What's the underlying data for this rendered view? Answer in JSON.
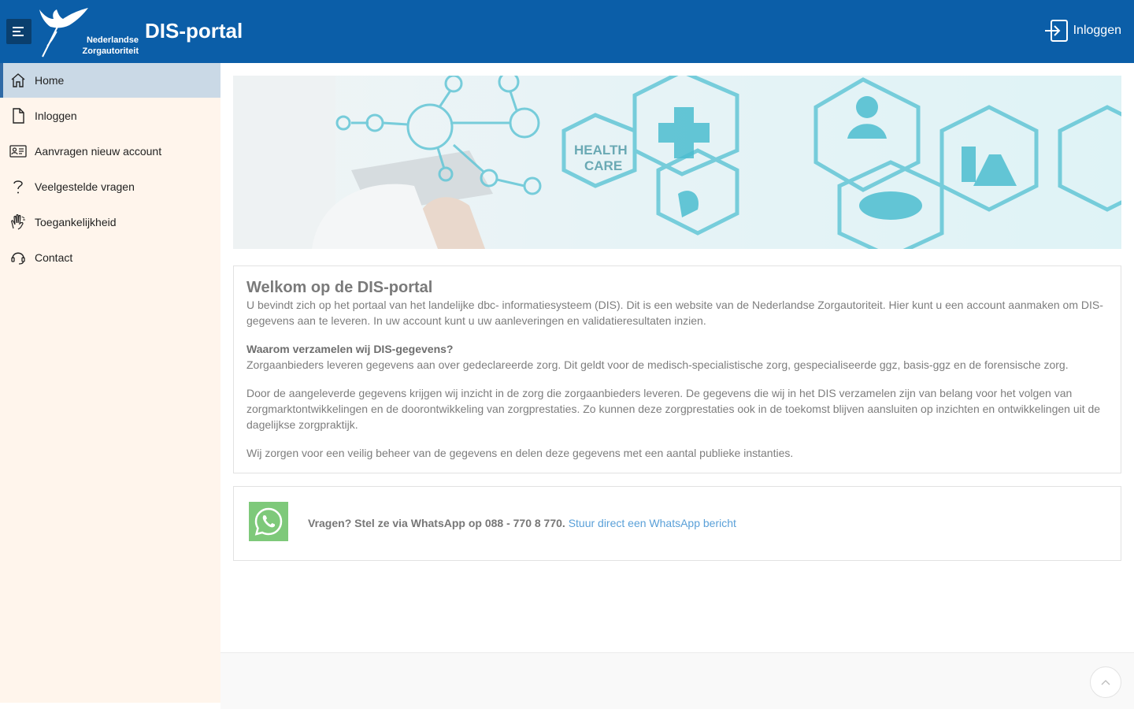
{
  "header": {
    "logo_line1": "Nederlandse",
    "logo_line2": "Zorgautoriteit",
    "title": "DIS-portal",
    "login_label": "Inloggen"
  },
  "sidebar": {
    "items": [
      {
        "label": "Home",
        "icon": "home-icon",
        "active": true
      },
      {
        "label": "Inloggen",
        "icon": "document-icon",
        "active": false
      },
      {
        "label": "Aanvragen nieuw account",
        "icon": "id-card-icon",
        "active": false
      },
      {
        "label": "Veelgestelde vragen",
        "icon": "question-icon",
        "active": false
      },
      {
        "label": "Toegankelijkheid",
        "icon": "accessibility-icon",
        "active": false
      },
      {
        "label": "Contact",
        "icon": "headset-icon",
        "active": false
      }
    ]
  },
  "banner": {
    "text_line1": "HEALTH",
    "text_line2": "CARE"
  },
  "welcome": {
    "title": "Welkom op de DIS-portal",
    "intro": "U bevindt zich op het portaal van het landelijke dbc- informatiesysteem (DIS). Dit is een website van de Nederlandse Zorgautoriteit. Hier kunt u een account aanmaken om DIS-gegevens aan te leveren. In uw account kunt u uw aanleveringen en validatieresultaten inzien.",
    "question_heading": "Waarom verzamelen wij DIS-gegevens?",
    "para1": "Zorgaanbieders leveren gegevens aan over gedeclareerde zorg. Dit geldt voor de medisch-specialistische zorg, gespecialiseerde ggz, basis-ggz en de forensische zorg.",
    "para2": "Door de aangeleverde gegevens krijgen wij inzicht in de zorg die zorgaanbieders leveren. De gegevens die wij in het DIS verzamelen zijn van belang voor het volgen van zorgmarktontwikkelingen en de doorontwikkeling van zorgprestaties. Zo kunnen deze zorgprestaties ook in de toekomst blijven aansluiten op inzichten en ontwikkelingen uit de dagelijkse zorgpraktijk.",
    "para3": "Wij zorgen voor een veilig beheer van de gegevens en delen deze gegevens met een aantal publieke instanties."
  },
  "whatsapp": {
    "bold_text": "Vragen? Stel ze via WhatsApp op 088 - 770 8 770.",
    "link_text": "Stuur direct een WhatsApp bericht"
  },
  "colors": {
    "header_bg": "#0b5ea8",
    "sidebar_bg": "#fff5ec",
    "active_bg": "#cad9e6",
    "link": "#5aa0d8",
    "whatsapp_green": "#7ec97a"
  }
}
